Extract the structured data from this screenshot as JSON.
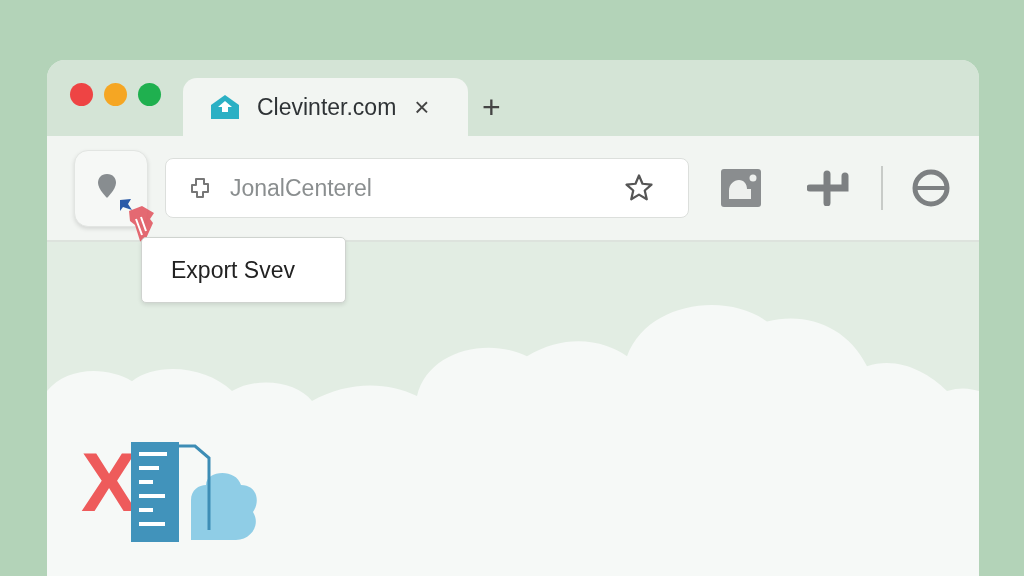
{
  "window": {
    "traffic_lights": [
      {
        "color": "#ee4444"
      },
      {
        "color": "#f5a623"
      },
      {
        "color": "#1fb04f"
      }
    ]
  },
  "tabs": [
    {
      "title": "Clevinter.com",
      "close": "×",
      "selected": true
    }
  ],
  "new_tab": "+",
  "address_bar": {
    "placeholder": "JonalCenterel",
    "starred": false
  },
  "tooltip": {
    "text": "Export Svev"
  },
  "logo": {
    "letter": "X"
  }
}
